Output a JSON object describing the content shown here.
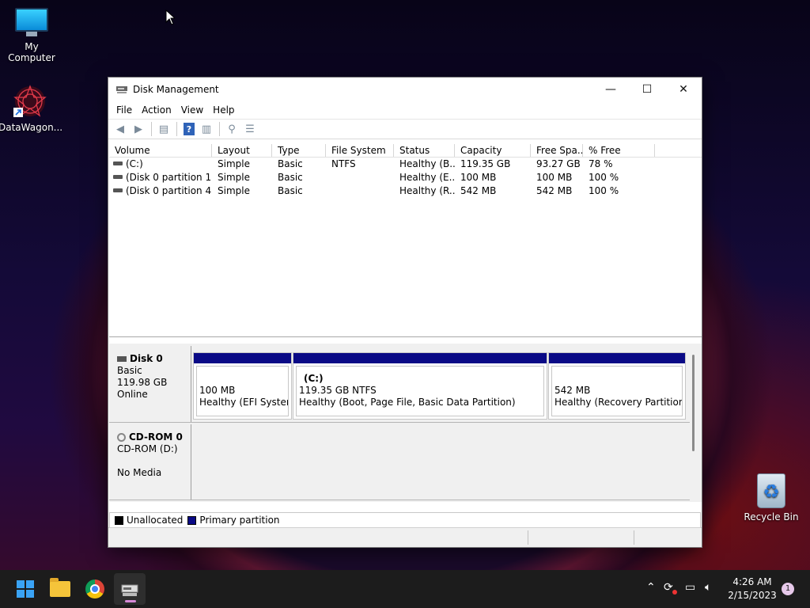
{
  "desktop": {
    "icons": [
      {
        "label": "My Computer",
        "icon": "monitor-icon"
      },
      {
        "label": "DataWagon...",
        "icon": "datawagon-icon"
      },
      {
        "label": "Recycle Bin",
        "icon": "recycle-bin-icon"
      }
    ]
  },
  "window": {
    "title": "Disk Management",
    "controls": {
      "minimize": "—",
      "maximize": "☐",
      "close": "✕"
    },
    "menu": [
      "File",
      "Action",
      "View",
      "Help"
    ],
    "toolbar": [
      "back-arrow-icon",
      "forward-arrow-icon",
      "console-tree-icon",
      "help-icon",
      "properties-icon",
      "rescan-icon",
      "list-icon"
    ],
    "volume_list": {
      "columns": [
        "Volume",
        "Layout",
        "Type",
        "File System",
        "Status",
        "Capacity",
        "Free Spa...",
        "% Free"
      ],
      "rows": [
        {
          "volume": "(C:)",
          "layout": "Simple",
          "type": "Basic",
          "fs": "NTFS",
          "status": "Healthy (B...",
          "capacity": "119.35 GB",
          "free": "93.27 GB",
          "pct": "78 %"
        },
        {
          "volume": "(Disk 0 partition 1)",
          "layout": "Simple",
          "type": "Basic",
          "fs": "",
          "status": "Healthy (E...",
          "capacity": "100 MB",
          "free": "100 MB",
          "pct": "100 %"
        },
        {
          "volume": "(Disk 0 partition 4)",
          "layout": "Simple",
          "type": "Basic",
          "fs": "",
          "status": "Healthy (R...",
          "capacity": "542 MB",
          "free": "542 MB",
          "pct": "100 %"
        }
      ]
    },
    "disks": [
      {
        "name": "Disk 0",
        "type": "Basic",
        "size": "119.98 GB",
        "state": "Online",
        "partitions": [
          {
            "name": "",
            "size": "100 MB",
            "status": "Healthy (EFI System P"
          },
          {
            "name": "(C:)",
            "size": "119.35 GB NTFS",
            "status": "Healthy (Boot, Page File, Basic Data Partition)"
          },
          {
            "name": "",
            "size": "542 MB",
            "status": "Healthy (Recovery Partition)"
          }
        ]
      },
      {
        "name": "CD-ROM 0",
        "type": "CD-ROM (D:)",
        "media": "No Media"
      }
    ],
    "legend": [
      {
        "label": "Unallocated",
        "color": "#000000"
      },
      {
        "label": "Primary partition",
        "color": "#0a0a86"
      }
    ]
  },
  "taskbar": {
    "apps": [
      "start-icon",
      "file-explorer-icon",
      "chrome-icon",
      "disk-management-icon"
    ],
    "time": "4:26 AM",
    "date": "2/15/2023",
    "notifications": "1"
  }
}
